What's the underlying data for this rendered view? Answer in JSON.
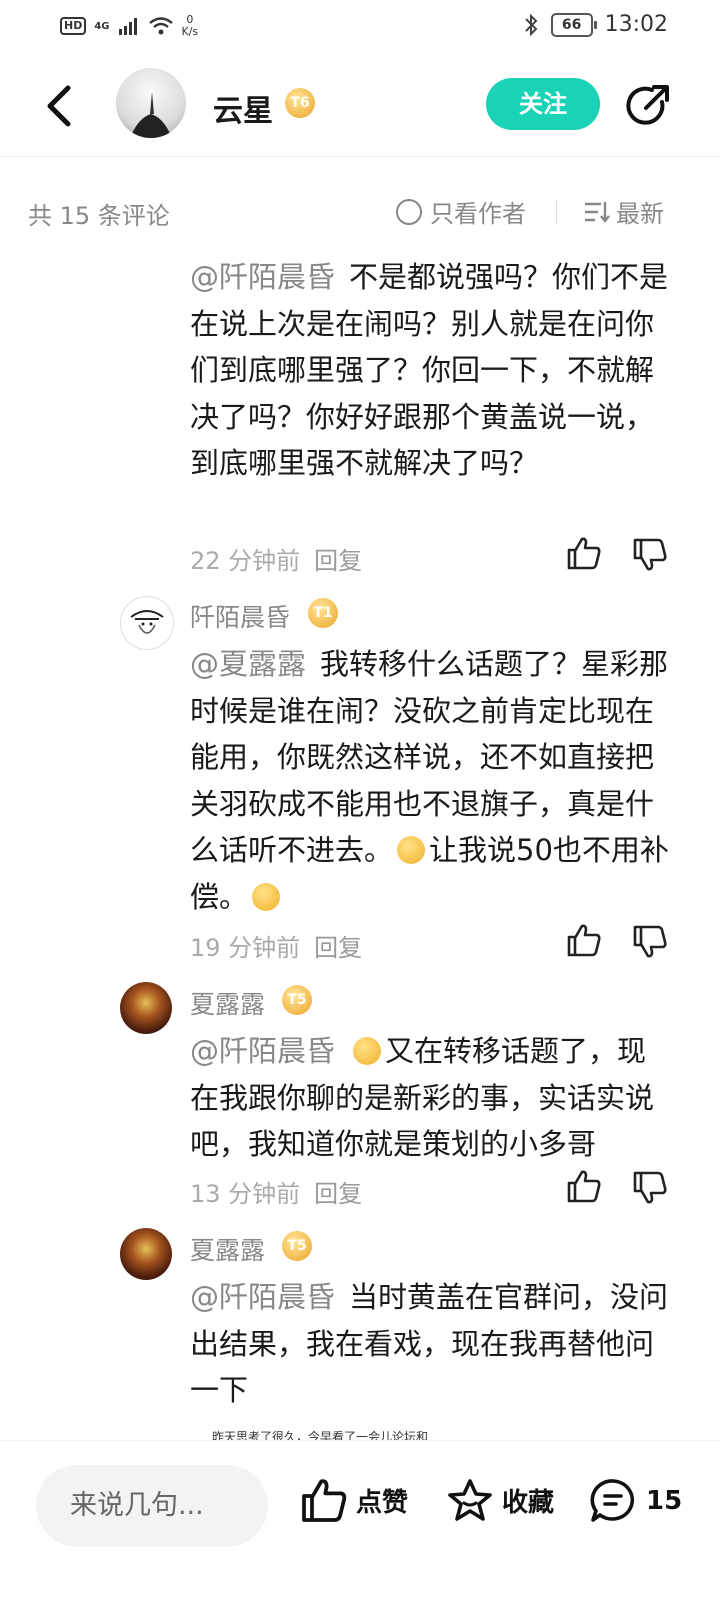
{
  "status_bar": {
    "hd": "HD",
    "net_type": "4G",
    "speed_value": "0",
    "speed_unit": "K/s",
    "battery": "66",
    "time": "13:02"
  },
  "header": {
    "author_name": "云星",
    "level_badge": "T6",
    "follow_label": "关注"
  },
  "filter": {
    "count_label": "共 15 条评论",
    "only_author_label": "只看作者",
    "sort_label": "最新"
  },
  "comments": [
    {
      "mention": "@阡陌晨昏",
      "text": "不是都说强吗？你们不是在说上次是在闹吗？别人就是在问你们到底哪里强了？你回一下，不就解决了吗？你好好跟那个黄盖说一说，到底哪里强不就解决了吗？",
      "time": "22 分钟前",
      "reply_label": "回复"
    },
    {
      "user": "阡陌晨昏",
      "level_badge": "T1",
      "mention": "@夏露露",
      "text_part1": "我转移什么话题了？星彩那时候是谁在闹？没砍之前肯定比现在能用，你既然这样说，还不如直接把关羽砍成不能用也不退旗子，真是什么话听不进去。",
      "text_part2": "让我说50也不用补偿。",
      "time": "19 分钟前",
      "reply_label": "回复"
    },
    {
      "user": "夏露露",
      "level_badge": "T5",
      "mention": "@阡陌晨昏",
      "text": "又在转移话题了，现在我跟你聊的是新彩的事，实话实说吧，我知道你就是策划的小多哥",
      "time": "13 分钟前",
      "reply_label": "回复"
    },
    {
      "user": "夏露露",
      "level_badge": "T5",
      "mention": "@阡陌晨昏",
      "text": "当时黄盖在官群问，没问出结果，我在看戏，现在我再替他问一下"
    }
  ],
  "preview_snippet": "昨天思考了很久，今早看了一会儿论坛和",
  "bottom_bar": {
    "input_placeholder": "来说几句...",
    "like_label": "点赞",
    "favorite_label": "收藏",
    "comment_count": "15"
  },
  "colors": {
    "accent": "#1ad3b6",
    "badge_gold": "#f3b84a",
    "muted_text": "#888888"
  }
}
